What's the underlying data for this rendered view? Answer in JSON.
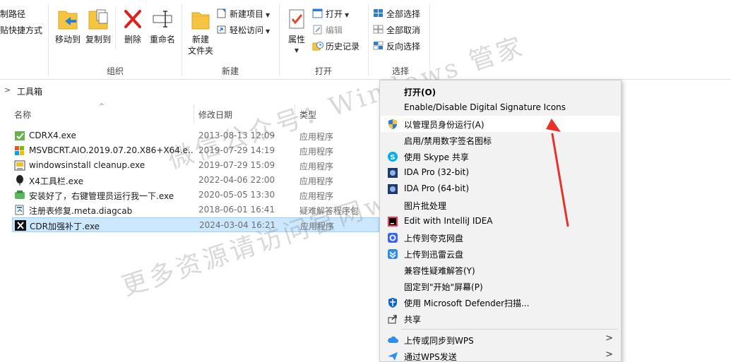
{
  "ribbon": {
    "clipboard_partial": {
      "copy_path": "制路径",
      "paste_shortcut": "贴快捷方式",
      "group_label": "组织"
    },
    "organize": {
      "move_to": "移动到",
      "copy_to": "复制到",
      "delete": "删除",
      "rename": "重命名"
    },
    "new_group": {
      "new_folder": "新建\n文件夹",
      "new_item": "新建项目",
      "easy_access": "轻松访问",
      "group_label": "新建"
    },
    "open_group": {
      "properties": "属性",
      "open": "打开",
      "edit": "编辑",
      "history": "历史记录",
      "group_label": "打开"
    },
    "select_group": {
      "select_all": "全部选择",
      "select_none": "全部取消",
      "invert": "反向选择",
      "group_label": "选择"
    }
  },
  "address": {
    "crumb": "工具箱"
  },
  "columns": {
    "name": "名称",
    "modified": "修改日期",
    "type": "类型"
  },
  "files": [
    {
      "name": "CDRX4.exe",
      "date": "2013-08-13 12:09",
      "type": "应用程序",
      "icon": "cdr-green-check-icon"
    },
    {
      "name": "MSVBCRT.AIO.2019.07.20.X86+X64.e...",
      "date": "2019-07-29 14:19",
      "type": "应用程序",
      "icon": "windows-logo-icon"
    },
    {
      "name": "windowsinstall cleanup.exe",
      "date": "2019-07-29 15:09",
      "type": "应用程序",
      "icon": "installer-icon"
    },
    {
      "name": "X4工具栏.exe",
      "date": "2022-04-06 22:00",
      "type": "应用程序",
      "icon": "balloon-icon"
    },
    {
      "name": "安装好了，右键管理员运行我一下.exe",
      "date": "2020-05-05 13:30",
      "type": "应用程序",
      "icon": "green-app-icon"
    },
    {
      "name": "注册表修复.meta.diagcab",
      "date": "2018-06-01 16:41",
      "type": "疑难解答程序包",
      "icon": "diagcab-icon"
    },
    {
      "name": "CDR加强补丁.exe",
      "date": "2024-03-04 16:21",
      "type": "应用程序",
      "icon": "x-logo-icon"
    }
  ],
  "context_menu": {
    "items": [
      {
        "label": "打开(O)",
        "icon": "",
        "bold": true
      },
      {
        "label": "Enable/Disable Digital Signature Icons",
        "icon": ""
      },
      {
        "label": "以管理员身份运行(A)",
        "icon": "shield-icon",
        "hover": true
      },
      {
        "label": "启用/禁用数字签名图标",
        "icon": ""
      },
      {
        "label": "使用 Skype 共享",
        "icon": "skype-icon"
      },
      {
        "label": "IDA Pro (32-bit)",
        "icon": "ida-icon"
      },
      {
        "label": "IDA Pro (64-bit)",
        "icon": "ida-icon"
      },
      {
        "label": "图片批处理",
        "icon": ""
      },
      {
        "label": "Edit with IntelliJ IDEA",
        "icon": "intellij-icon"
      },
      {
        "label": "上传到夸克网盘",
        "icon": "quark-icon"
      },
      {
        "label": "上传到迅雷云盘",
        "icon": "xunlei-icon"
      },
      {
        "label": "兼容性疑难解答(Y)",
        "icon": ""
      },
      {
        "label": "固定到\"开始\"屏幕(P)",
        "icon": ""
      },
      {
        "label": "使用 Microsoft Defender扫描...",
        "icon": "defender-icon"
      },
      {
        "label": "共享",
        "icon": "share-icon"
      },
      {
        "label": "上传或同步到WPS",
        "icon": "wps-cloud-icon",
        "submenu": true
      },
      {
        "label": "通过WPS发送",
        "icon": "wps-send-icon",
        "submenu": true
      }
    ]
  },
  "watermark": {
    "line1": "微信公众号：Windows 管家",
    "line2": "更多资源请访问官网www.macku.pro"
  },
  "colors": {
    "selection_bg": "#cce8ff",
    "selection_border": "#99d1ff",
    "menu_bg": "#f2f2f2",
    "annotation_arrow": "#e8322a"
  }
}
